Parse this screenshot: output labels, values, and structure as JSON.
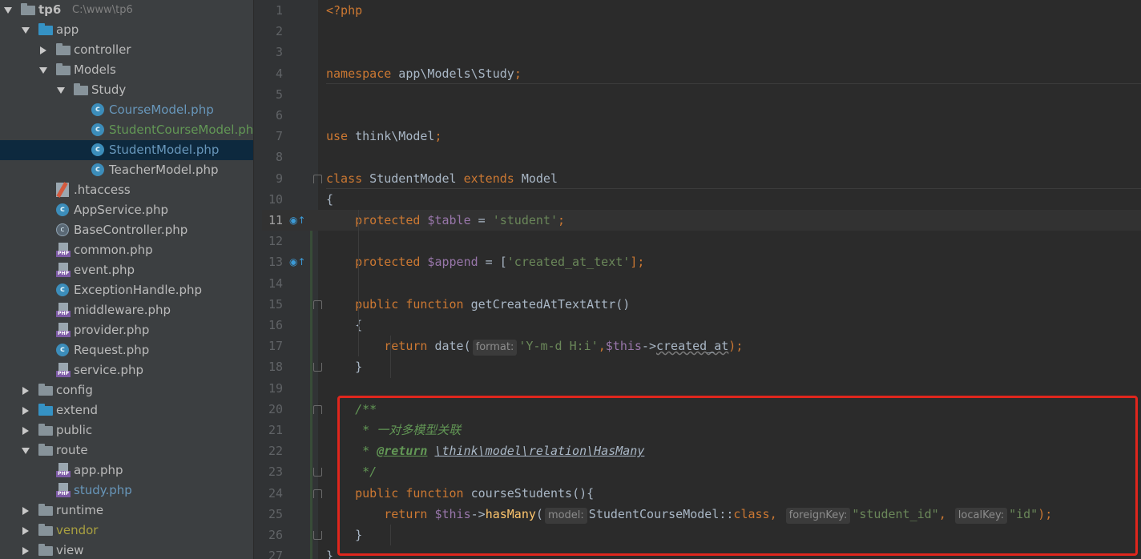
{
  "project_tree": [
    {
      "label": "tp6",
      "path_hint": "C:\\www\\tp6",
      "depth": 0,
      "kind": "folder",
      "expanded": true,
      "bold": true
    },
    {
      "label": "app",
      "depth": 1,
      "kind": "folder-blue",
      "expanded": true
    },
    {
      "label": "controller",
      "depth": 2,
      "kind": "folder",
      "expanded": false
    },
    {
      "label": "Models",
      "depth": 2,
      "kind": "folder",
      "expanded": true
    },
    {
      "label": "Study",
      "depth": 3,
      "kind": "folder",
      "expanded": true
    },
    {
      "label": "CourseModel.php",
      "depth": 4,
      "kind": "class",
      "color": "blue"
    },
    {
      "label": "StudentCourseModel.php",
      "depth": 4,
      "kind": "class",
      "color": "green"
    },
    {
      "label": "StudentModel.php",
      "depth": 4,
      "kind": "class",
      "color": "blue",
      "selected": true
    },
    {
      "label": "TeacherModel.php",
      "depth": 4,
      "kind": "class"
    },
    {
      "label": ".htaccess",
      "depth": 2,
      "kind": "htaccess"
    },
    {
      "label": "AppService.php",
      "depth": 2,
      "kind": "class"
    },
    {
      "label": "BaseController.php",
      "depth": 2,
      "kind": "abstract"
    },
    {
      "label": "common.php",
      "depth": 2,
      "kind": "php"
    },
    {
      "label": "event.php",
      "depth": 2,
      "kind": "php"
    },
    {
      "label": "ExceptionHandle.php",
      "depth": 2,
      "kind": "class"
    },
    {
      "label": "middleware.php",
      "depth": 2,
      "kind": "php"
    },
    {
      "label": "provider.php",
      "depth": 2,
      "kind": "php"
    },
    {
      "label": "Request.php",
      "depth": 2,
      "kind": "class"
    },
    {
      "label": "service.php",
      "depth": 2,
      "kind": "php"
    },
    {
      "label": "config",
      "depth": 1,
      "kind": "folder",
      "expanded": false
    },
    {
      "label": "extend",
      "depth": 1,
      "kind": "folder-blue",
      "expanded": false
    },
    {
      "label": "public",
      "depth": 1,
      "kind": "folder",
      "expanded": false
    },
    {
      "label": "route",
      "depth": 1,
      "kind": "folder",
      "expanded": true
    },
    {
      "label": "app.php",
      "depth": 2,
      "kind": "php"
    },
    {
      "label": "study.php",
      "depth": 2,
      "kind": "php",
      "color": "blue"
    },
    {
      "label": "runtime",
      "depth": 1,
      "kind": "folder",
      "expanded": false
    },
    {
      "label": "vendor",
      "depth": 1,
      "kind": "folder",
      "expanded": false,
      "color": "yellow"
    },
    {
      "label": "view",
      "depth": 1,
      "kind": "folder",
      "expanded": false
    }
  ],
  "editor": {
    "current_line": 11,
    "lines": [
      {
        "n": "1",
        "tokens": [
          {
            "t": "<?php",
            "c": "kw"
          }
        ]
      },
      {
        "n": "2",
        "tokens": []
      },
      {
        "n": "3",
        "tokens": []
      },
      {
        "n": "4",
        "tokens": [
          {
            "t": "namespace",
            "c": "kw"
          },
          {
            "t": " app\\Models\\Study",
            "c": ""
          },
          {
            "t": ";",
            "c": "kw"
          }
        ]
      },
      {
        "n": "5",
        "tokens": []
      },
      {
        "n": "6",
        "tokens": []
      },
      {
        "n": "7",
        "tokens": [
          {
            "t": "use",
            "c": "kw"
          },
          {
            "t": " think\\Model",
            "c": ""
          },
          {
            "t": ";",
            "c": "kw"
          }
        ]
      },
      {
        "n": "8",
        "tokens": []
      },
      {
        "n": "9",
        "tokens": [
          {
            "t": "class",
            "c": "kw"
          },
          {
            "t": " StudentModel ",
            "c": ""
          },
          {
            "t": "extends",
            "c": "kw"
          },
          {
            "t": " Model",
            "c": ""
          }
        ]
      },
      {
        "n": "10",
        "tokens": [
          {
            "t": "{",
            "c": ""
          }
        ]
      },
      {
        "n": "11",
        "tokens": [
          {
            "t": "    protected",
            "c": "kw"
          },
          {
            "t": " $table",
            "c": "var"
          },
          {
            "t": " = ",
            "c": ""
          },
          {
            "t": "'student'",
            "c": "str"
          },
          {
            "t": ";",
            "c": "kw"
          }
        ]
      },
      {
        "n": "12",
        "tokens": []
      },
      {
        "n": "13",
        "tokens": [
          {
            "t": "    protected",
            "c": "kw"
          },
          {
            "t": " $append",
            "c": "var"
          },
          {
            "t": " = [",
            "c": ""
          },
          {
            "t": "'created_at_text'",
            "c": "str"
          },
          {
            "t": "];",
            "c": "kw"
          }
        ]
      },
      {
        "n": "14",
        "tokens": []
      },
      {
        "n": "15",
        "tokens": [
          {
            "t": "    public",
            "c": "kw"
          },
          {
            "t": " function",
            "c": "kw"
          },
          {
            "t": " getCreatedAtTextAttr",
            "c": "fn-decl"
          },
          {
            "t": "()",
            "c": ""
          }
        ]
      },
      {
        "n": "16",
        "tokens": [
          {
            "t": "    {",
            "c": ""
          }
        ]
      },
      {
        "n": "17",
        "tokens": [
          {
            "t": "        return",
            "c": "kw"
          },
          {
            "t": " date(",
            "c": ""
          },
          {
            "t": "format:",
            "c": "hint"
          },
          {
            "t": "'Y-m-d H:i'",
            "c": "str"
          },
          {
            "t": ",",
            "c": "kw"
          },
          {
            "t": "$this",
            "c": "var"
          },
          {
            "t": "->",
            "c": ""
          },
          {
            "t": "created_at",
            "c": "wavy"
          },
          {
            "t": ");",
            "c": "kw"
          }
        ]
      },
      {
        "n": "18",
        "tokens": [
          {
            "t": "    }",
            "c": ""
          }
        ]
      },
      {
        "n": "19",
        "tokens": []
      },
      {
        "n": "20",
        "tokens": [
          {
            "t": "    /**",
            "c": "doc"
          }
        ]
      },
      {
        "n": "21",
        "tokens": [
          {
            "t": "     * 一对多模型关联",
            "c": "doc"
          }
        ]
      },
      {
        "n": "22",
        "tokens": [
          {
            "t": "     * ",
            "c": "doc"
          },
          {
            "t": "@return",
            "c": "doctag"
          },
          {
            "t": " ",
            "c": "doc"
          },
          {
            "t": "\\think\\model\\relation\\HasMany",
            "c": "docref"
          }
        ]
      },
      {
        "n": "23",
        "tokens": [
          {
            "t": "     */",
            "c": "doc"
          }
        ]
      },
      {
        "n": "24",
        "tokens": [
          {
            "t": "    public",
            "c": "kw"
          },
          {
            "t": " function",
            "c": "kw"
          },
          {
            "t": " courseStudents",
            "c": "fn-decl"
          },
          {
            "t": "(){",
            "c": ""
          }
        ]
      },
      {
        "n": "25",
        "tokens": [
          {
            "t": "        return",
            "c": "kw"
          },
          {
            "t": " $this",
            "c": "var"
          },
          {
            "t": "->",
            "c": ""
          },
          {
            "t": "hasMany",
            "c": "fn"
          },
          {
            "t": "(",
            "c": ""
          },
          {
            "t": "model:",
            "c": "hint"
          },
          {
            "t": "StudentCourseModel::",
            "c": ""
          },
          {
            "t": "class",
            "c": "kw"
          },
          {
            "t": ", ",
            "c": "kw"
          },
          {
            "t": "foreignKey:",
            "c": "hint"
          },
          {
            "t": "\"student_id\"",
            "c": "str"
          },
          {
            "t": ", ",
            "c": "kw"
          },
          {
            "t": "localKey:",
            "c": "hint"
          },
          {
            "t": "\"id\"",
            "c": "str"
          },
          {
            "t": ");",
            "c": "kw"
          }
        ]
      },
      {
        "n": "26",
        "tokens": [
          {
            "t": "    }",
            "c": ""
          }
        ]
      },
      {
        "n": "27",
        "tokens": [
          {
            "t": "}",
            "c": ""
          }
        ]
      }
    ]
  },
  "colors": {
    "sidebar_bg": "#3c3f41",
    "editor_bg": "#2b2b2b",
    "keyword": "#cc7832",
    "variable": "#9876aa",
    "string": "#6a8759",
    "doc_comment": "#629755",
    "highlight_box": "#e0261d"
  }
}
